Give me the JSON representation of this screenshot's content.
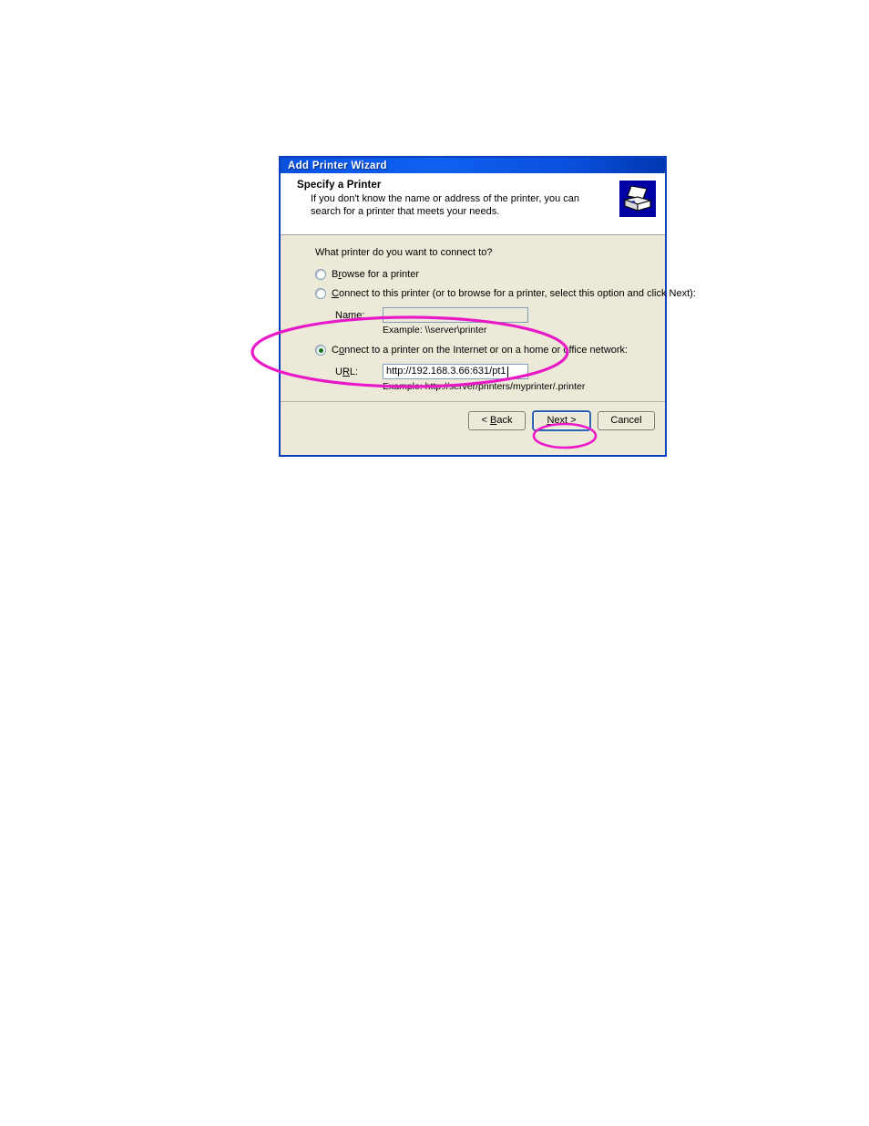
{
  "window": {
    "title": "Add Printer Wizard"
  },
  "header": {
    "title": "Specify a Printer",
    "description": "If you don't know the name or address of the printer, you can search for a printer that meets your needs.",
    "icon": "printer-icon"
  },
  "body": {
    "question": "What printer do you want to connect to?",
    "options": [
      {
        "id": "browse",
        "label_prefix": "B",
        "label_underlined": "r",
        "label_suffix": "owse for a printer",
        "selected": false
      },
      {
        "id": "connect-named",
        "label_prefix": "",
        "label_underlined": "C",
        "label_suffix": "onnect to this printer (or to browse for a printer, select this option and click Next):",
        "selected": false
      },
      {
        "id": "connect-url",
        "label_prefix": "C",
        "label_underlined": "o",
        "label_suffix": "nnect to a printer on the Internet or on a home or office network:",
        "selected": true
      }
    ],
    "name_field": {
      "label": "Name:",
      "value": "",
      "placeholder": "",
      "enabled": false
    },
    "name_example": "Example: \\\\server\\printer",
    "url_field": {
      "label_prefix": "U",
      "label_underlined": "R",
      "label_suffix": "L:",
      "value": "http://192.168.3.66:631/pt1",
      "placeholder": "",
      "enabled": true
    },
    "url_example": "Example: http://server/printers/myprinter/.printer"
  },
  "footer": {
    "back_label": "< Back",
    "back_underlined": "B",
    "next_label": "Next >",
    "next_underlined": "N",
    "cancel_label": "Cancel"
  },
  "annotations": {
    "color": "#ea19c8",
    "shapes": [
      {
        "name": "url-section-highlight",
        "type": "ellipse"
      },
      {
        "name": "next-button-highlight",
        "type": "ellipse"
      }
    ]
  }
}
